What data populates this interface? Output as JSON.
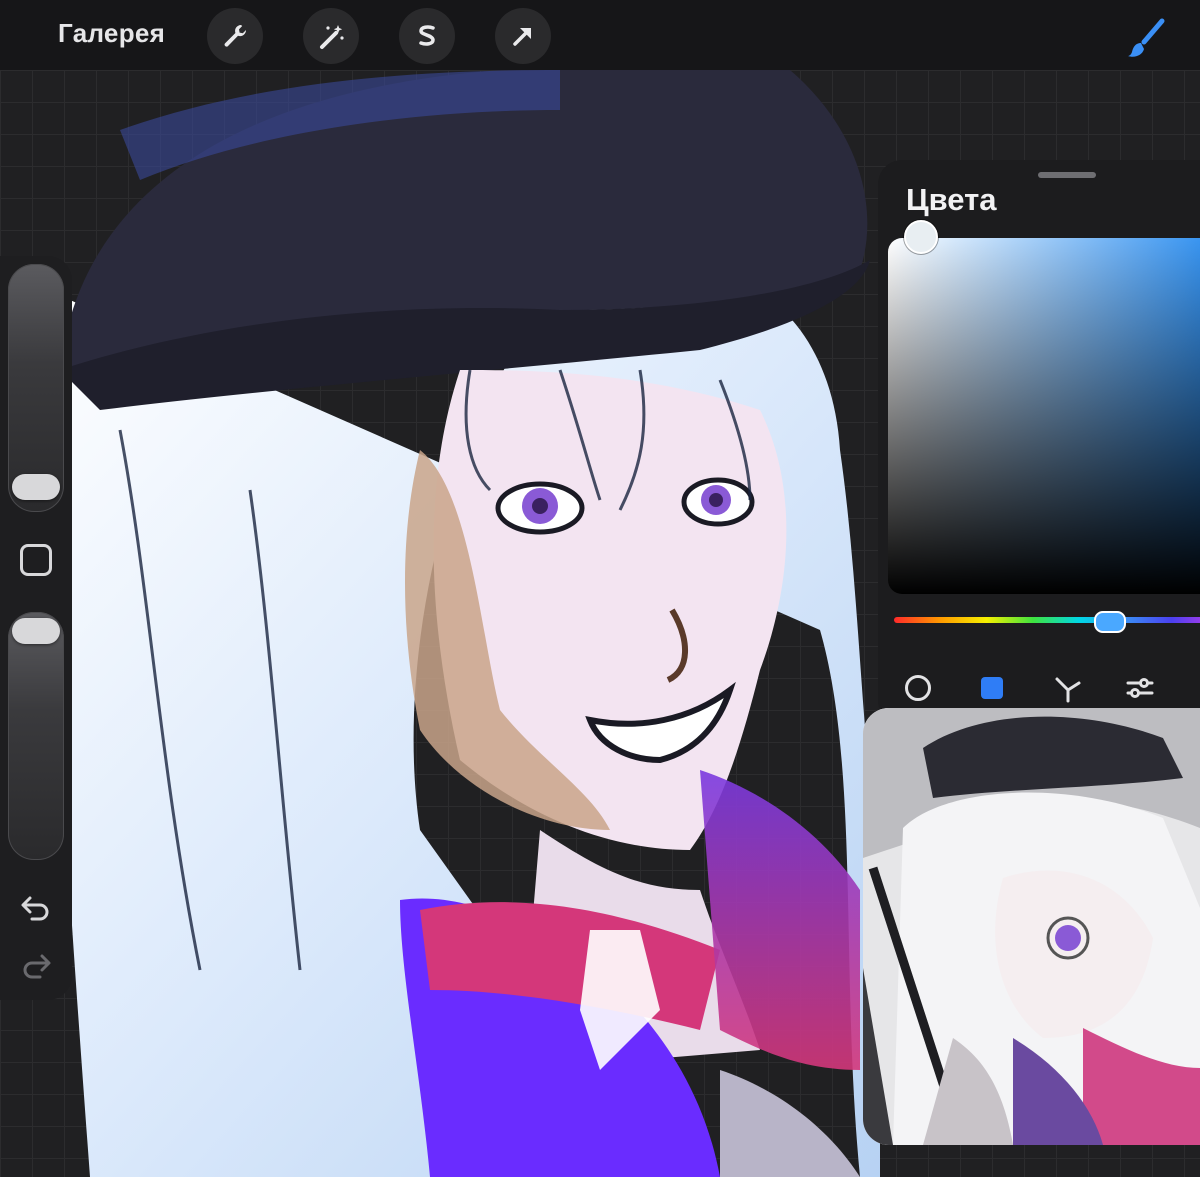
{
  "app": {
    "gallery_label": "Галерея"
  },
  "toolbar": {
    "tools": [
      {
        "name": "actions",
        "icon": "wrench-icon"
      },
      {
        "name": "adjustments",
        "icon": "magic-wand-icon"
      },
      {
        "name": "selection",
        "icon": "selection-s-icon"
      },
      {
        "name": "transform",
        "icon": "arrow-cursor-icon"
      }
    ],
    "active_tool": {
      "name": "brush",
      "icon": "brush-icon",
      "color": "#3a8ff5"
    }
  },
  "sidebar": {
    "brush_size_level": 0.85,
    "opacity_level": 0.05,
    "undo_icon": "undo-icon",
    "redo_icon": "redo-icon"
  },
  "colors_panel": {
    "title": "Цвета",
    "current_color": "#e6eef2",
    "hue_color": "#2e8ff0",
    "modes": [
      {
        "name": "disc",
        "icon": "circle-icon"
      },
      {
        "name": "classic",
        "icon": "square-icon",
        "active": true,
        "color": "#2f7df6"
      },
      {
        "name": "harmony",
        "icon": "harmony-icon"
      },
      {
        "name": "value",
        "icon": "sliders-icon"
      }
    ]
  },
  "reference_window": {
    "icon": "reference-image"
  },
  "palette": {
    "hair": "#dbe9fb",
    "hat": "#2a2a3c",
    "skin": "#f3e4f1",
    "accent_purple": "#6a2cff",
    "accent_pink": "#d4377a"
  }
}
